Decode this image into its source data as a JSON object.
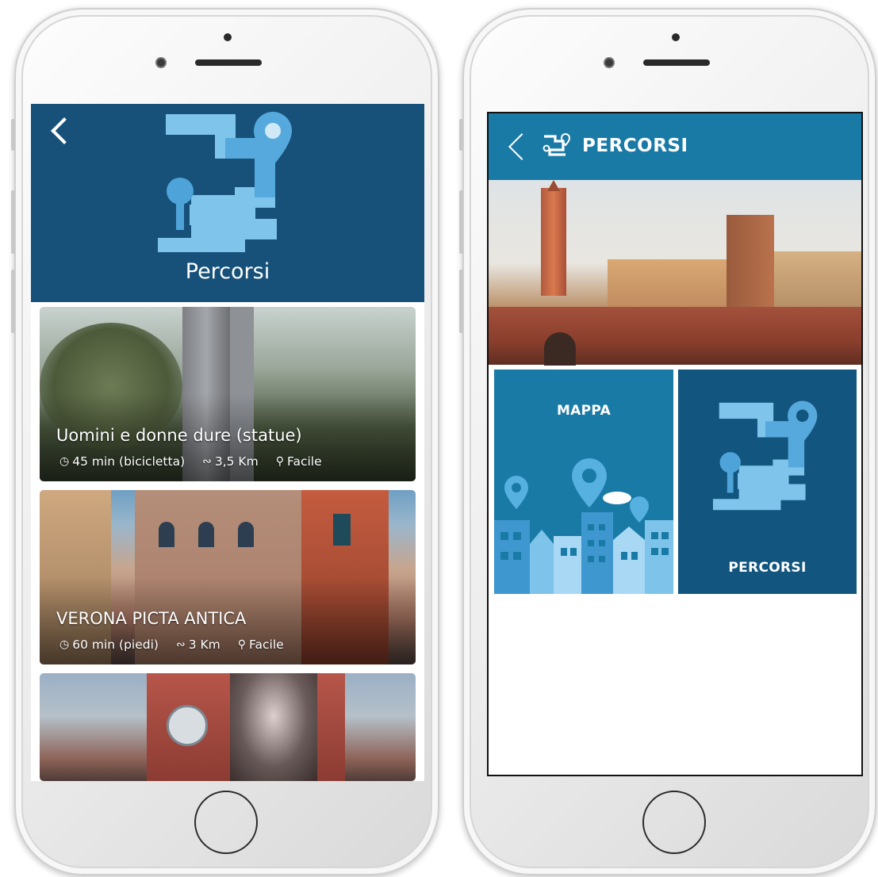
{
  "left_screen": {
    "header": {
      "back_icon": "chevron-left-icon",
      "hero_icon": "route-pin-icon",
      "title": "Percorsi",
      "background_color": "#17517a"
    },
    "routes": [
      {
        "title": "Uomini e donne dure (statue)",
        "duration": "45 min (bicicletta)",
        "distance": "3,5 Km",
        "difficulty": "Facile"
      },
      {
        "title": "VERONA PICTA ANTICA",
        "duration": "60 min (piedi)",
        "distance": "3 Km",
        "difficulty": "Facile"
      },
      {
        "title": "",
        "duration": "",
        "distance": "",
        "difficulty": ""
      }
    ],
    "meta_icons": {
      "duration": "clock-icon",
      "distance": "path-icon",
      "difficulty": "hiker-icon"
    }
  },
  "right_screen": {
    "header": {
      "back_icon": "chevron-left-icon",
      "title_icon": "route-pin-icon",
      "title": "PERCORSI",
      "background_color": "#1a7aa6"
    },
    "tiles": [
      {
        "label": "MAPPA",
        "icon": "city-map-icon",
        "color": "#1a7aa6"
      },
      {
        "label": "PERCORSI",
        "icon": "route-pin-icon",
        "color": "#12557f"
      }
    ]
  }
}
